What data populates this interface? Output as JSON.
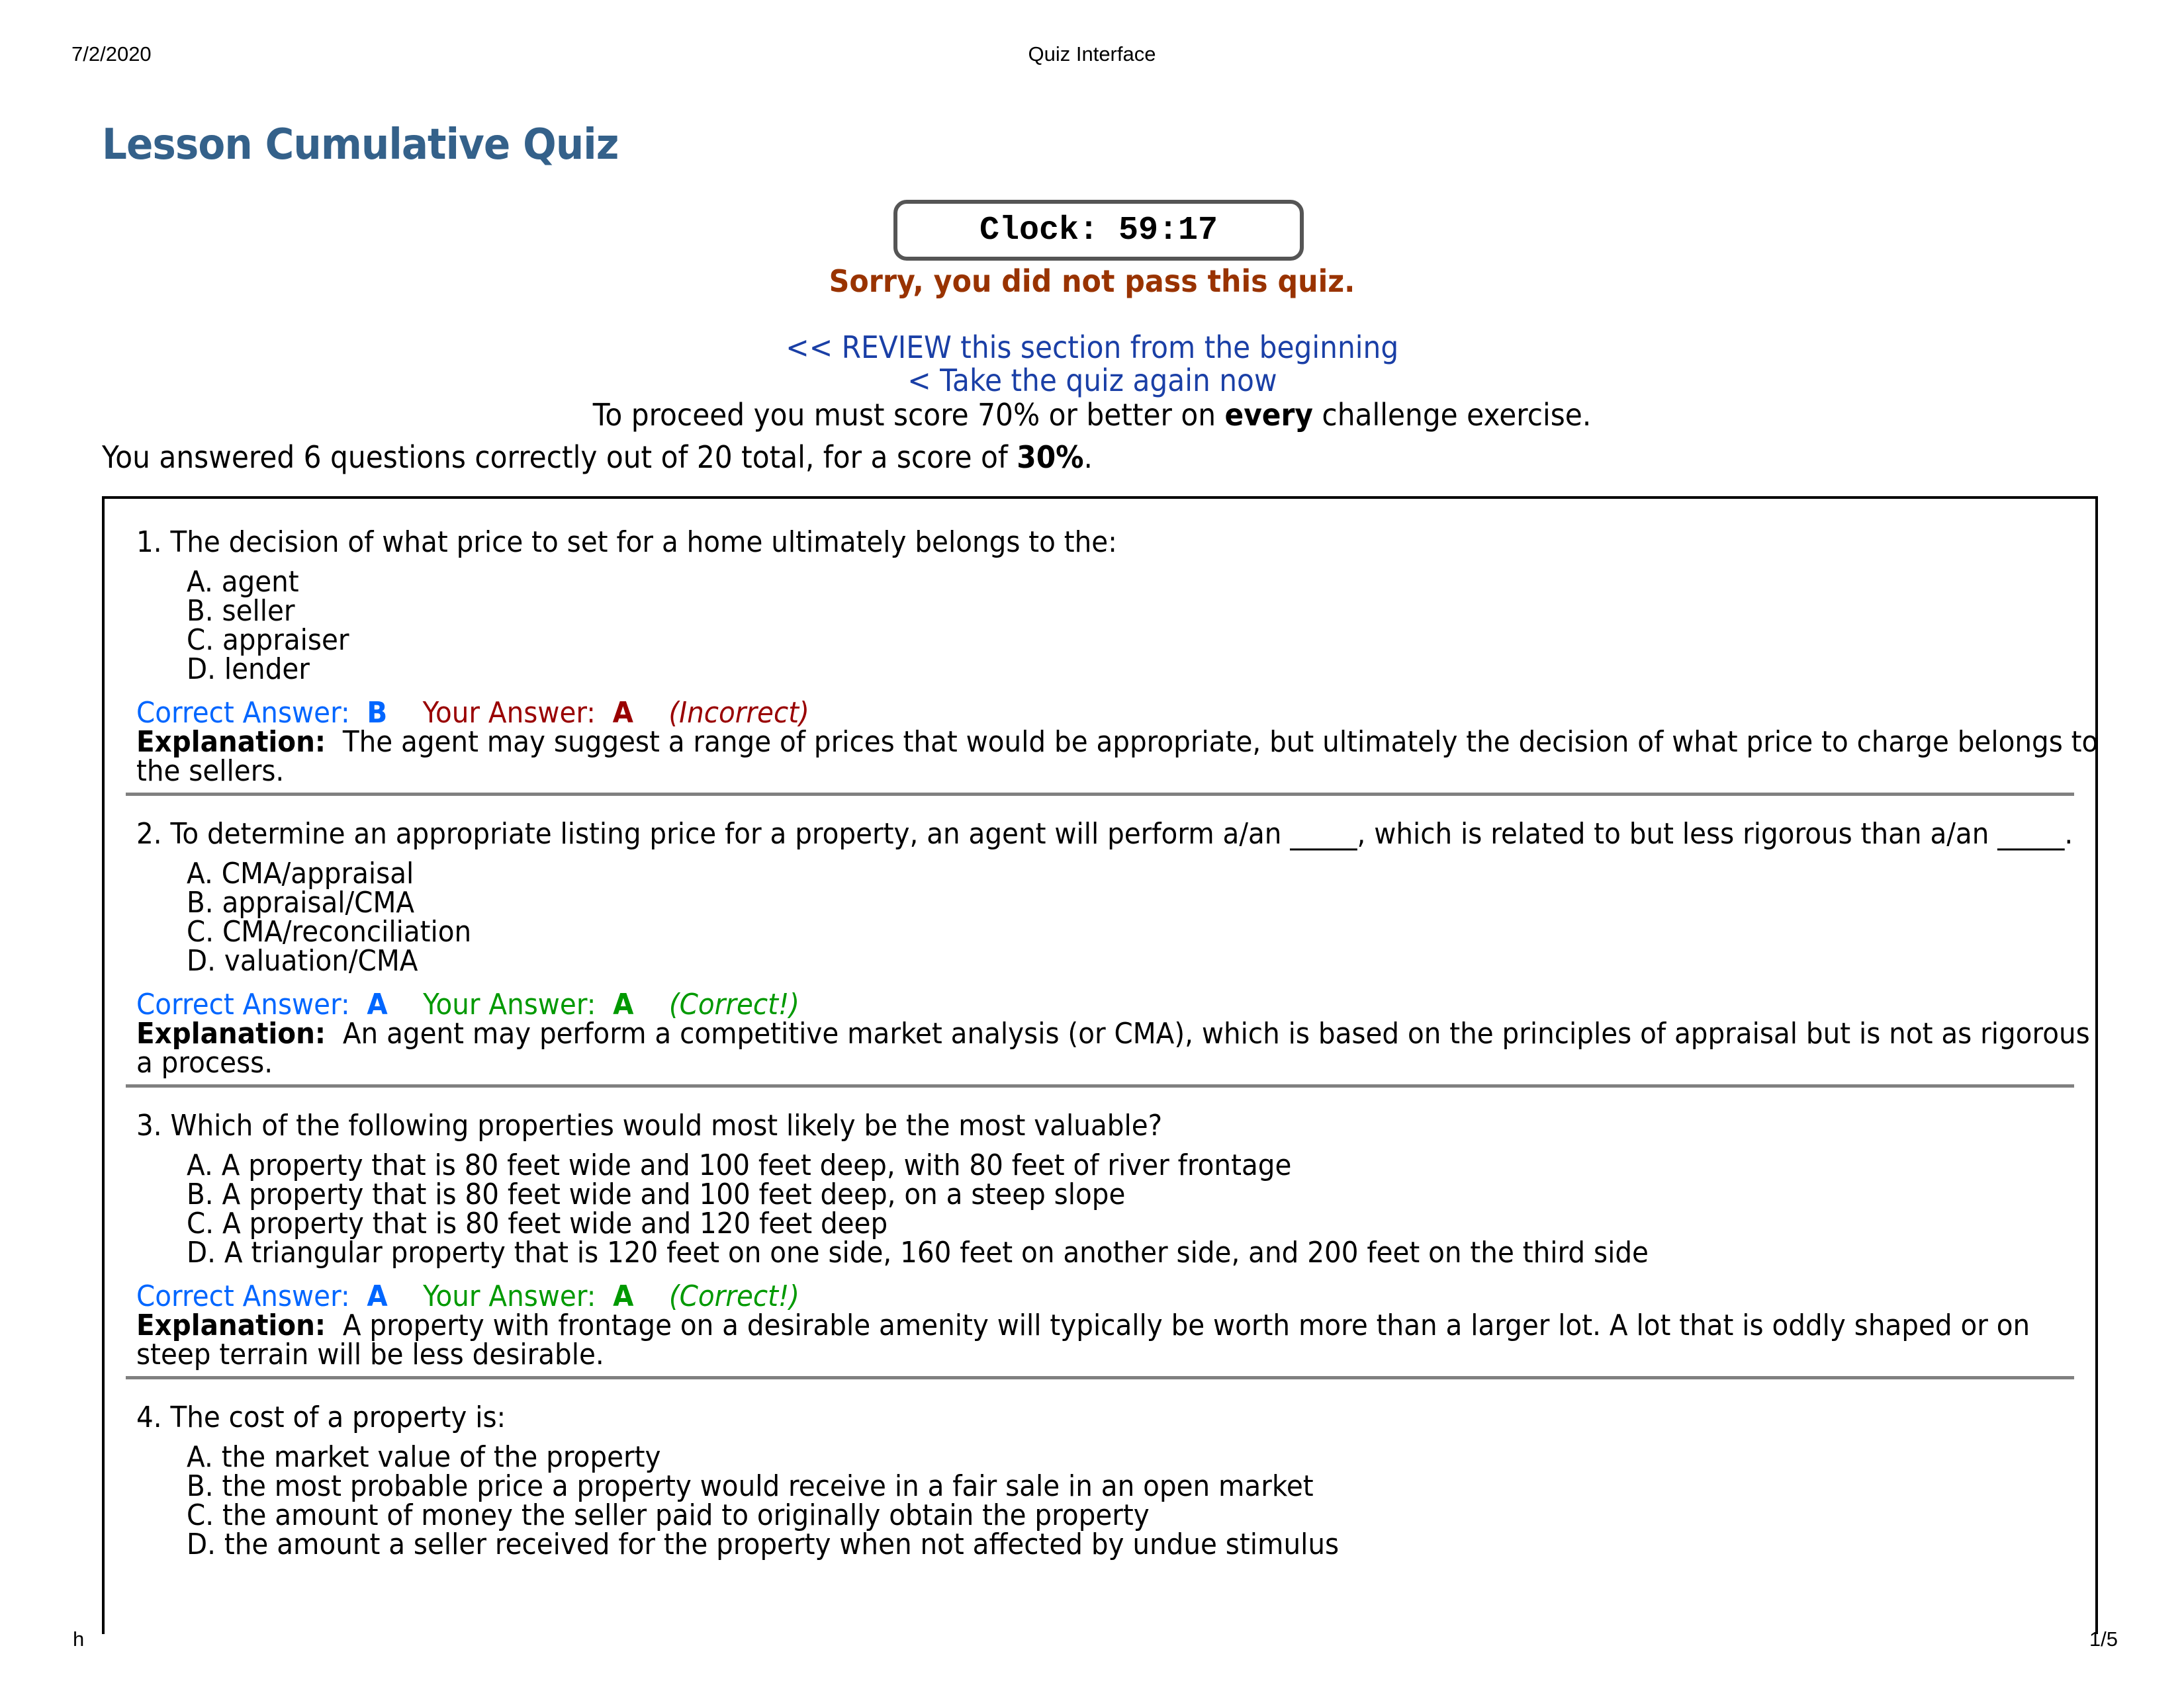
{
  "print_header": {
    "date": "7/2/2020",
    "title": "Quiz Interface"
  },
  "print_footer": {
    "left": "h",
    "page": "1/5"
  },
  "page_title": "Lesson Cumulative Quiz",
  "clock": {
    "label": "Clock:",
    "value": "59:17",
    "display": "Clock: 59:17"
  },
  "result_message": "Sorry, you did not pass this quiz.",
  "links": {
    "review": "<< REVIEW this section from the beginning",
    "retake": "< Take the quiz again now"
  },
  "proceed": {
    "prefix": "To proceed you must score 70% or better on ",
    "emphasis": "every",
    "suffix": " challenge exercise."
  },
  "score": {
    "prefix": "You answered 6 questions correctly out of 20 total, for a score of ",
    "value": "30%",
    "suffix": ".",
    "correct": 6,
    "total": 20
  },
  "labels": {
    "correct_answer": "Correct Answer:",
    "your_answer": "Your Answer:",
    "explanation": "Explanation:"
  },
  "colors": {
    "title": "#34618a",
    "fail": "#993300",
    "link": "#1a3fa6",
    "correct_answer": "#0066ff",
    "incorrect": "#990000",
    "correct": "#009900"
  },
  "questions": [
    {
      "text": "1. The decision of what price to set for a home ultimately belongs to the:",
      "options": [
        "A. agent",
        "B. seller",
        "C. appraiser",
        "D. lender"
      ],
      "correct_answer": "B",
      "your_answer": "A",
      "status": "(Incorrect)",
      "explanation": "The agent may suggest a range of prices that would be appropriate, but ultimately the decision of what price to charge belongs to the sellers."
    },
    {
      "text": "2. To determine an appropriate listing price for a property, an agent will perform a/an _____, which is related to but less rigorous than a/an _____.",
      "options": [
        "A. CMA/appraisal",
        "B. appraisal/CMA",
        "C. CMA/reconciliation",
        "D. valuation/CMA"
      ],
      "correct_answer": "A",
      "your_answer": "A",
      "status": "(Correct!)",
      "explanation": "An agent may perform a competitive market analysis (or CMA), which is based on the principles of appraisal but is not as rigorous a process."
    },
    {
      "text": "3. Which of the following properties would most likely be the most valuable?",
      "options": [
        "A. A property that is 80 feet wide and 100 feet deep, with 80 feet of river frontage",
        "B. A property that is 80 feet wide and 100 feet deep, on a steep slope",
        "C. A property that is 80 feet wide and 120 feet deep",
        "D. A triangular property that is 120 feet on one side, 160 feet on another side, and 200 feet on the third side"
      ],
      "correct_answer": "A",
      "your_answer": "A",
      "status": "(Correct!)",
      "explanation": "A property with frontage on a desirable amenity will typically be worth more than a larger lot. A lot that is oddly shaped or on steep terrain will be less desirable."
    },
    {
      "text": "4. The cost of a property is:",
      "options": [
        "A. the market value of the property",
        "B. the most probable price a property would receive in a fair sale in an open market",
        "C. the amount of money the seller paid to originally obtain the property",
        "D. the amount a seller received for the property when not affected by undue stimulus"
      ]
    }
  ]
}
